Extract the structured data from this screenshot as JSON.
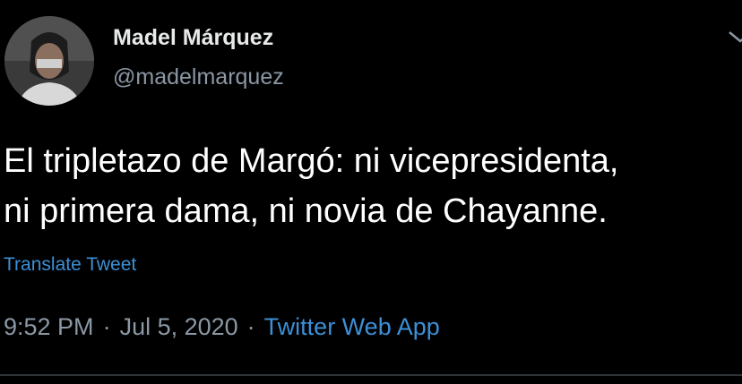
{
  "tweet": {
    "author": {
      "name": "Madel Márquez",
      "handle": "@madelmarquez"
    },
    "text_lines": [
      "El tripletazo de Margó: ni vicepresidenta,",
      "ni primera dama, ni novia de Chayanne."
    ],
    "translate_label": "Translate Tweet",
    "time": "9:52 PM",
    "date": "Jul 5, 2020",
    "separator": "·",
    "source": "Twitter Web App"
  },
  "icons": {
    "menu": "chevron-down-icon"
  },
  "colors": {
    "background": "#000000",
    "text": "#ffffff",
    "secondary_text": "#8b98a5",
    "link": "#3d8fd6",
    "divider": "#2f3336"
  }
}
